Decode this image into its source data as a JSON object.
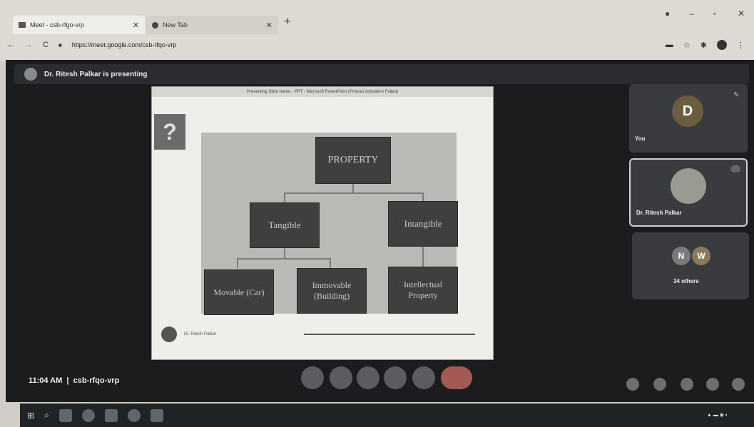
{
  "browser": {
    "tabs": [
      {
        "label": "Meet - csb-rfgo-vrp"
      },
      {
        "label": "New Tab"
      }
    ],
    "url": "https://meet.google.com/csb-rfqo-vrp"
  },
  "meet": {
    "presenting_text": "Dr. Ritesh Palkar is presenting",
    "presentation": {
      "window_title": "Presenting Slide Name - PPT - Microsoft PowerPoint (Product Activation Failed)",
      "footer_text": "Dr. Ritesh Palkar",
      "question_mark": "?",
      "diagram": {
        "root": "PROPERTY",
        "level1": [
          "Tangible",
          "Intangible"
        ],
        "level2": [
          "Movable (Car)",
          "Immovable (Building)",
          "Intellectual Property"
        ]
      }
    },
    "participants": {
      "you_initial": "D",
      "you_label": "You",
      "presenter_label": "Dr. Ritesh Palkar",
      "others_initials": [
        "N",
        "W"
      ],
      "others_label": "34 others"
    },
    "meeting_info": "11:04 AM  |  csb-rfqo-vrp"
  },
  "colors": {
    "meet_bg": "#1b1c1e",
    "avatar_you": "#6b5e3c",
    "avatar_n": "#7a7a7a",
    "avatar_w": "#8a7a5a",
    "end_call": "#a35a55"
  }
}
